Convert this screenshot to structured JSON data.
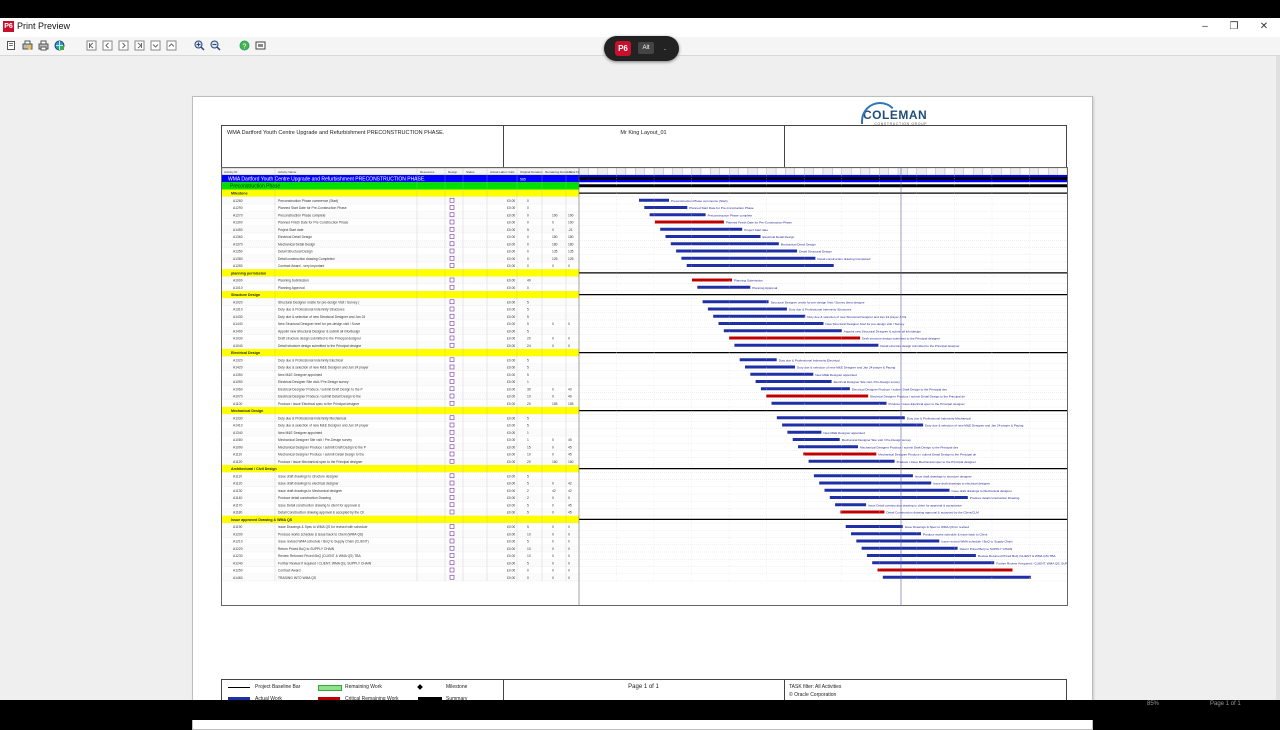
{
  "window": {
    "title": "Print Preview",
    "app_icon": "P6"
  },
  "window_controls": {
    "minimize": "–",
    "maximize": "❐",
    "close": "✕"
  },
  "toolbar": {
    "buttons": [
      "page-setup-icon",
      "print-setup-icon",
      "print-icon",
      "publish-icon",
      "first-page-icon",
      "previous-page-icon",
      "next-page-icon",
      "last-page-icon",
      "page-down-icon",
      "page-up-icon",
      "zoom-in-icon",
      "zoom-out-icon",
      "help-icon",
      "fit-page-icon"
    ]
  },
  "overlay": {
    "app": "P6",
    "key": "Alt",
    "extra": "."
  },
  "report": {
    "project_title": "WMA Dartford Youth Centre Upgrade and Refurbishment PRECONSTRUCTION PHASE.",
    "layout_name": "Mr King Layout_01",
    "logo_text": "COLEMAN",
    "logo_sub": "CONSTRUCTION GROUP",
    "columns": [
      "Activity ID",
      "Activity Name",
      "Resources",
      "Design",
      "Status",
      "Actual Labor Units",
      "Original Duration",
      "Remaining Duration",
      "Total Float"
    ],
    "wbs_title": "WMA Dartford Youth Centre Upgrade and Refurbishment PRECONSTRUCTION PHASE.",
    "phase": "Preconstruction Phase"
  },
  "rows": [
    {
      "t": "g",
      "name": "Milestone"
    },
    {
      "t": "a",
      "id": "A1260",
      "name": "Preconstruction Phase commence (Start)",
      "od": "0",
      "rd": "",
      "tf": "",
      "bar": "Preconstruction Phase commence (Start)"
    },
    {
      "t": "a",
      "id": "A1290",
      "name": "Planned Start Date for Pre-Construction Phase",
      "od": "0",
      "rd": "",
      "tf": "",
      "bar": "Planned Start Date for Pre-Construction Phase"
    },
    {
      "t": "a",
      "id": "A1270",
      "name": "Preconstruction Phase complete",
      "od": "0",
      "rd": "190",
      "tf": "190",
      "bar": "Preconstruction Phase complete"
    },
    {
      "t": "a",
      "id": "A1300",
      "name": "Planned Finish Date for Pre-Construction Phase",
      "od": "0",
      "rd": "0",
      "tf": "190",
      "bar": "Planned Finish Date for Pre-Construction Phase"
    },
    {
      "t": "a",
      "id": "A1450",
      "name": "Project Start date",
      "od": "5",
      "rd": "0",
      "tf": "-21",
      "bar": "Project Start date"
    },
    {
      "t": "a",
      "id": "A1360",
      "name": "Electrical Detail Design",
      "od": "0",
      "rd": "180",
      "tf": "180",
      "bar": "Electrical Detail Design"
    },
    {
      "t": "a",
      "id": "A1370",
      "name": "Mechanical Detail Design",
      "od": "0",
      "rd": "180",
      "tf": "180",
      "bar": "Mechanical Detail Design"
    },
    {
      "t": "a",
      "id": "A1350",
      "name": "Detail Structural Design",
      "od": "0",
      "rd": "135",
      "tf": "135",
      "bar": "Detail Structural Design"
    },
    {
      "t": "a",
      "id": "A1380",
      "name": "Detail construction drawing Completed",
      "od": "0",
      "rd": "125",
      "tf": "125",
      "bar": "Detail construction drawing Completed"
    },
    {
      "t": "a",
      "id": "A1280",
      "name": "Contract Award - very important",
      "od": "0",
      "rd": "0",
      "tf": "0",
      "bar": ""
    },
    {
      "t": "g",
      "name": "planning permission"
    },
    {
      "t": "a",
      "id": "A1000",
      "name": "Planning Submission",
      "od": "40",
      "rd": "",
      "tf": "",
      "bar": "Planning Submission"
    },
    {
      "t": "a",
      "id": "A1010",
      "name": "Planning Approval",
      "od": "0",
      "rd": "",
      "tf": "",
      "bar": "Planning Approval"
    },
    {
      "t": "g",
      "name": "Structure Design"
    },
    {
      "t": "a",
      "id": "A1020",
      "name": "Structural Designer onsite for pre-design Visit / Survey (best designer)",
      "od": "5",
      "rd": "",
      "tf": "",
      "bar": "Structural Designer onsite for pre-design Visit / Survey (best designer)"
    },
    {
      "t": "a",
      "id": "A1310",
      "name": "Duty due & Professional Indemnity Structures",
      "od": "5",
      "rd": "",
      "tf": "",
      "bar": "Duty due & Professional Indemnity Structures"
    },
    {
      "t": "a",
      "id": "A1430",
      "name": "Duty due & selection of new Structural Designer and Jan 24 prayer",
      "od": "5",
      "rd": "",
      "tf": "",
      "bar": "Duty due & selection of new Structural Designer and Jan 24 prayer & Pacing"
    },
    {
      "t": "a",
      "id": "A1440",
      "name": "New Structural Designer brief for pre-design visit / Survey",
      "od": "5",
      "rd": "0",
      "tf": "0",
      "bar": "New Structural Designer brief for pre-design visit / Survey"
    },
    {
      "t": "a",
      "id": "A1400",
      "name": "Appoint new Structural Designer & submit all info/design",
      "od": "5",
      "rd": "",
      "tf": "",
      "bar": "Appoint new Structural Designer & submit all info/design"
    },
    {
      "t": "a",
      "id": "A1030",
      "name": "Draft structure design submitted to the Principal designer",
      "od": "20",
      "rd": "0",
      "tf": "0",
      "bar": "Draft structure design submitted to the Principal designer"
    },
    {
      "t": "a",
      "id": "A1040",
      "name": "Detail structure design submitted to the Principal designer",
      "od": "24",
      "rd": "0",
      "tf": "0",
      "bar": "Detail structure design submitted to the Principal designer"
    },
    {
      "t": "g",
      "name": "Electrical Design"
    },
    {
      "t": "a",
      "id": "A1320",
      "name": "Duty due & Professional Indemnity Electrical",
      "od": "5",
      "rd": "",
      "tf": "",
      "bar": "Duty due & Professional Indemnity Electrical"
    },
    {
      "t": "a",
      "id": "A1420",
      "name": "Duty due & selection of new M&E Designer and Jan 24 prayer & Pa",
      "od": "5",
      "rd": "",
      "tf": "",
      "bar": "Duty due & selection of new M&E Designer and Jan 24 prayer & Pacing"
    },
    {
      "t": "a",
      "id": "A1350",
      "name": "New M&E Designer appointed",
      "od": "5",
      "rd": "",
      "tf": "",
      "bar": "New M&E Designer appointed"
    },
    {
      "t": "a",
      "id": "A1050",
      "name": "Electrical Designer Site visit / Pre-Design survey",
      "od": "1",
      "rd": "",
      "tf": "",
      "bar": "Electrical Designer Site visit / Pre-Design survey"
    },
    {
      "t": "a",
      "id": "A1060",
      "name": "Electrical Designer Produce / submit Draft Design to the Principal des",
      "od": "30",
      "rd": "0",
      "tf": "40",
      "bar": "Electrical Designer Produce / submit Draft Design to the Principal designer"
    },
    {
      "t": "a",
      "id": "A1070",
      "name": "Electrical Designer Produce / submit Detail Design to the Principal des",
      "od": "10",
      "rd": "0",
      "tf": "40",
      "bar": "Electrical Designer Produce / submit Detail Design to the Principal designer"
    },
    {
      "t": "a",
      "id": "A1100",
      "name": "Produce / issue Electrical spec to the Principal designer",
      "od": "20",
      "rd": "155",
      "tf": "155",
      "bar": "Produce / issue Electrical spec to the Principal designer"
    },
    {
      "t": "g",
      "name": "Mechanical Design"
    },
    {
      "t": "a",
      "id": "A1330",
      "name": "Duty due & Professional Indemnity Mechanical",
      "od": "5",
      "rd": "",
      "tf": "",
      "bar": "Duty due & Professional Indemnity Mechanical"
    },
    {
      "t": "a",
      "id": "A1410",
      "name": "Duty due & selection of new M&E Designer and Jan 24 prayer & Pac",
      "od": "5",
      "rd": "",
      "tf": "",
      "bar": "Duty due & selection of new M&E Designer and Jan 24 prayer & Pacing"
    },
    {
      "t": "a",
      "id": "A1340",
      "name": "New M&E Designer appointed",
      "od": "1",
      "rd": "",
      "tf": "",
      "bar": "New M&E Designer appointed"
    },
    {
      "t": "a",
      "id": "A1080",
      "name": "Mechanical Designer Site visit / Pre-Design survey",
      "od": "1",
      "rd": "0",
      "tf": "45",
      "bar": "Mechanical Designer Site visit / Pre-Design survey"
    },
    {
      "t": "a",
      "id": "A1090",
      "name": "Mechanical Designer Produce / submit Draft Design to the Principal",
      "od": "15",
      "rd": "0",
      "tf": "45",
      "bar": "Mechanical Designer Produce / submit Draft Design to the Principal designer"
    },
    {
      "t": "a",
      "id": "A1110",
      "name": "Mechanical Designer Produce / submit Detail Design to the Principal",
      "od": "10",
      "rd": "0",
      "tf": "45",
      "bar": "Mechanical Designer Produce / submit Detail Design to the Principal designer"
    },
    {
      "t": "a",
      "id": "A1120",
      "name": "Produce / issue Mechanical spec to the Principal designer",
      "od": "20",
      "rd": "160",
      "tf": "160",
      "bar": "Produce / issue Mechanical spec to the Principal designer"
    },
    {
      "t": "g",
      "name": "Architectural / Civil Design"
    },
    {
      "t": "a",
      "id": "A1110",
      "name": "Issue draft drawings to structure designer",
      "od": "5",
      "rd": "",
      "tf": "",
      "bar": "Issue draft drawings to structure designer"
    },
    {
      "t": "a",
      "id": "A1120",
      "name": "Issue draft drawings to electrical designer",
      "od": "5",
      "rd": "0",
      "tf": "42",
      "bar": "Issue draft drawings to electrical designer"
    },
    {
      "t": "a",
      "id": "A1130",
      "name": "Issue draft drawings to Mechanical designer",
      "od": "2",
      "rd": "42",
      "tf": "42",
      "bar": "Issue draft drawings to Mechanical designer"
    },
    {
      "t": "a",
      "id": "A1140",
      "name": "Produce detail construction Drawing",
      "od": "2",
      "rd": "0",
      "tf": "0",
      "bar": "Produce detail construction Drawing"
    },
    {
      "t": "a",
      "id": "A1170",
      "name": "Issue Detail construction drawing to client for approval & acceptance",
      "od": "5",
      "rd": "0",
      "tf": "45",
      "bar": "Issue Detail construction drawing to client for approval & acceptance"
    },
    {
      "t": "a",
      "id": "A1180",
      "name": "Detail Construction drawing approval & accepted by the Client/CLM",
      "od": "5",
      "rd": "0",
      "tf": "45",
      "bar": "Detail Construction drawing approval & accepted by the Client/CLM"
    },
    {
      "t": "g",
      "name": "Issue approved Drawing & WMA QS"
    },
    {
      "t": "a",
      "id": "A1190",
      "name": "Issue Drawings & Spec to WMA QS for revised with schedule of QLW",
      "od": "5",
      "rd": "0",
      "tf": "0",
      "bar": "Issue Drawings & Spec to WMA QS for revised"
    },
    {
      "t": "a",
      "id": "A1200",
      "name": "Produce works schedule & issue back to Client (WMA QS)",
      "od": "10",
      "rd": "0",
      "tf": "0",
      "bar": "Produce works schedule & issue back to Client"
    },
    {
      "t": "a",
      "id": "A1210",
      "name": "Issue revised WMA schedule / BoQ to Supply Chain (CLIENT)",
      "od": "5",
      "rd": "0",
      "tf": "0",
      "bar": "Issue revised WMA schedule / BoQ to Supply Chain"
    },
    {
      "t": "a",
      "id": "A1220",
      "name": "Return Priced BoQ to SUPPLY CHAIN",
      "od": "10",
      "rd": "0",
      "tf": "0",
      "bar": "Return Priced BoQ to SUPPLY CHAIN"
    },
    {
      "t": "a",
      "id": "A1230",
      "name": "Review Returned Priced BoQ (CLIENT & WMA QS) TBA",
      "od": "10",
      "rd": "0",
      "tf": "0",
      "bar": "Review Returned Priced BoQ (CLIENT & WMA QS) TBA"
    },
    {
      "t": "a",
      "id": "A1240",
      "name": "Further Review if required / CLIENT, WMA QS, SUPPLY CHAIN",
      "od": "5",
      "rd": "0",
      "tf": "0",
      "bar": "Further Review if required / CLIENT, WMA QS, SUPPLY CHAIN"
    },
    {
      "t": "a",
      "id": "A1250",
      "name": "Contract Award",
      "od": "0",
      "rd": "0",
      "tf": "0",
      "bar": ""
    },
    {
      "t": "a",
      "id": "A1460",
      "name": "TRADING INTO WMA QS",
      "od": "0",
      "rd": "0",
      "tf": "0",
      "bar": ""
    }
  ],
  "footer": {
    "legend": {
      "baseline": "Project Baseline Bar",
      "actual": "Actual Work",
      "remaining": "Remaining Work",
      "critical": "Critical Remaining Work",
      "milestone": "Milestone",
      "summary": "Summary"
    },
    "page": "Page 1 of 1",
    "filter": "TASK filter: All Activities",
    "copyright": "© Oracle Corporation"
  },
  "status_bar": {
    "zoom": "85%",
    "page": "Page 1 of 1"
  },
  "colors": {
    "wbs_band": "#0000ff",
    "phase_band": "#00e000",
    "group_band": "#ffff00",
    "actual": "#1f2fa5",
    "critical": "#c00000",
    "remaining": "#90e090",
    "summary": "#000000"
  }
}
